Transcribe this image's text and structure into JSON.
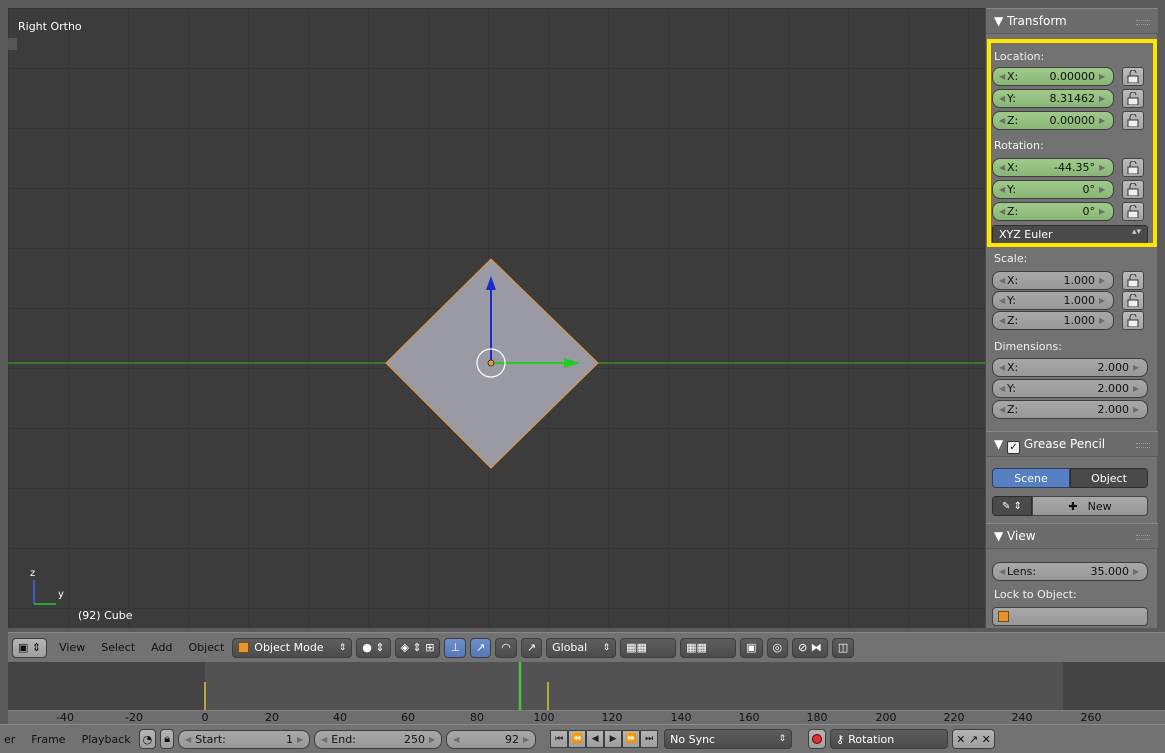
{
  "viewport": {
    "title": "Right Ortho",
    "object_label": "(92) Cube",
    "axis_y": "y",
    "axis_z": "z"
  },
  "npanel": {
    "transform": {
      "header": "▼ Transform",
      "location_label": "Location:",
      "location": [
        {
          "axis": "X:",
          "value": "0.00000"
        },
        {
          "axis": "Y:",
          "value": "8.31462"
        },
        {
          "axis": "Z:",
          "value": "0.00000"
        }
      ],
      "rotation_label": "Rotation:",
      "rotation": [
        {
          "axis": "X:",
          "value": "-44.35°"
        },
        {
          "axis": "Y:",
          "value": "0°"
        },
        {
          "axis": "Z:",
          "value": "0°"
        }
      ],
      "rotation_mode": "XYZ Euler",
      "scale_label": "Scale:",
      "scale": [
        {
          "axis": "X:",
          "value": "1.000"
        },
        {
          "axis": "Y:",
          "value": "1.000"
        },
        {
          "axis": "Z:",
          "value": "1.000"
        }
      ],
      "dimensions_label": "Dimensions:",
      "dimensions": [
        {
          "axis": "X:",
          "value": "2.000"
        },
        {
          "axis": "Y:",
          "value": "2.000"
        },
        {
          "axis": "Z:",
          "value": "2.000"
        }
      ]
    },
    "grease_pencil": {
      "header": "Grease Pencil",
      "scene_btn": "Scene",
      "object_btn": "Object",
      "new_btn": "New"
    },
    "view": {
      "header": "▼ View",
      "lens_label": "Lens:",
      "lens_value": "35.000",
      "lock_label": "Lock to Object:"
    }
  },
  "header3d": {
    "menus": [
      "View",
      "Select",
      "Add",
      "Object"
    ],
    "mode": "Object Mode",
    "orientation": "Global"
  },
  "timeline": {
    "ruler_ticks": [
      "-40",
      "-20",
      "0",
      "20",
      "40",
      "60",
      "80",
      "100",
      "120",
      "140",
      "160",
      "180",
      "200",
      "220",
      "240",
      "260"
    ],
    "menus": [
      "er",
      "Frame",
      "Playback"
    ],
    "start_label": "Start:",
    "start_value": "1",
    "end_label": "End:",
    "end_value": "250",
    "current_frame": "92",
    "sync": "No Sync",
    "keying_set": "Rotation"
  },
  "colors": {
    "highlight": "#ffe600",
    "green_field": "#9fca8a",
    "selected": "#5680c2"
  }
}
